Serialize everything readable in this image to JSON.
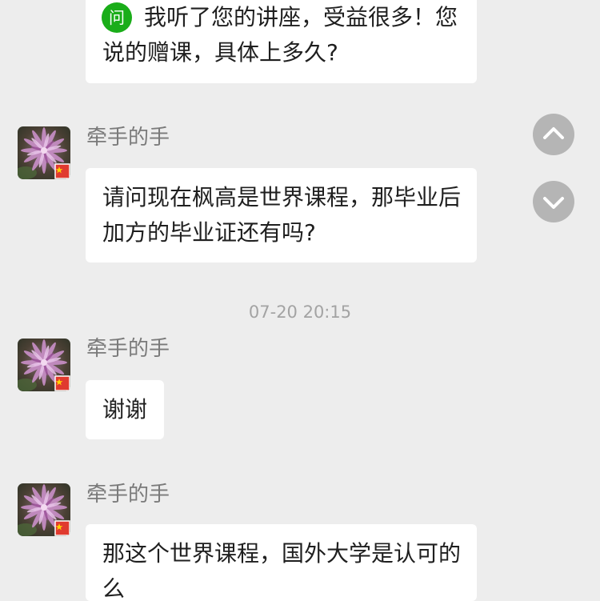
{
  "conversation": {
    "question": {
      "badge": "问",
      "lines": [
        "我听了您的讲座，受益很多！您",
        "说的赠课，具体上多久?"
      ]
    },
    "messages": [
      {
        "sender": "牵手的手",
        "avatar_icon": "flower-avatar",
        "lines": [
          "请问现在枫高是世界课程，那毕业后",
          "加方的毕业证还有吗?"
        ]
      },
      {
        "sender": "牵手的手",
        "avatar_icon": "flower-avatar",
        "lines": [
          "谢谢"
        ]
      },
      {
        "sender": "牵手的手",
        "avatar_icon": "flower-avatar",
        "lines": [
          "那这个世界课程，国外大学是认可的",
          "么"
        ]
      }
    ],
    "timestamp": "07-20 20:15"
  },
  "scroll_controls": {
    "up_icon": "chevron-up-icon",
    "down_icon": "chevron-down-icon"
  },
  "colors": {
    "background": "#ededed",
    "bubble": "#ffffff",
    "badge": "#1aad19",
    "text": "#1f1f1f",
    "sender": "#7a7a7a",
    "timestamp": "#a3a3a3",
    "scroll_button": "#b5b5b5"
  }
}
